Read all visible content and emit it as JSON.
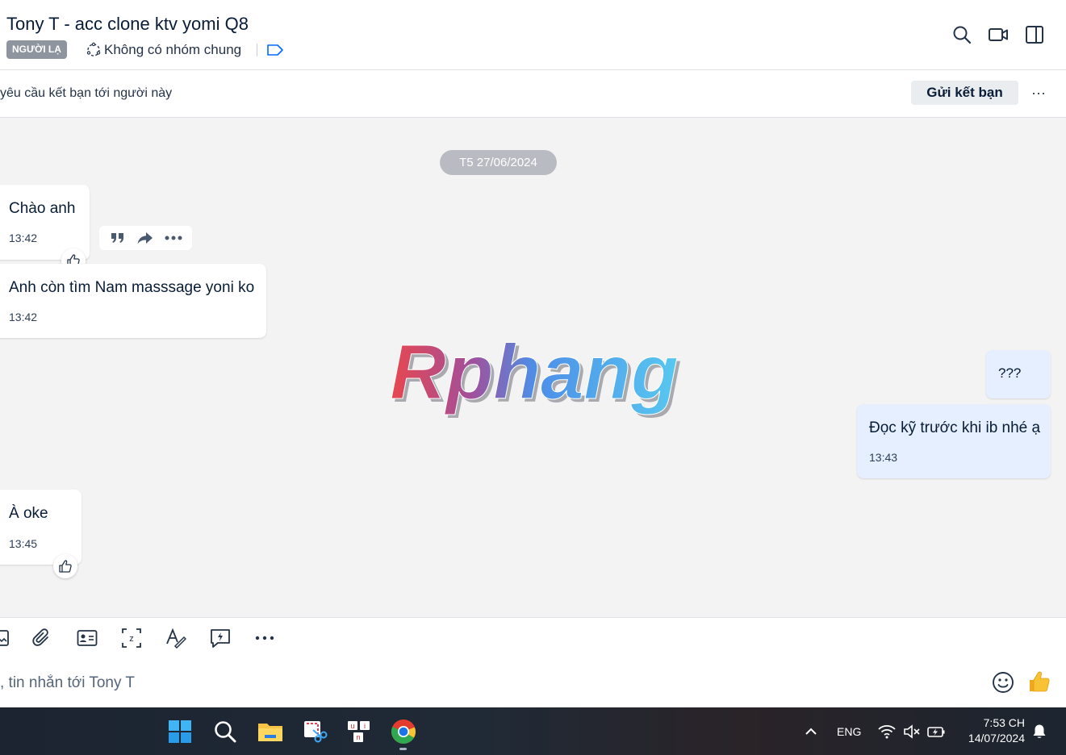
{
  "header": {
    "title": "Tony T - acc clone ktv yomi Q8",
    "badge": "NGƯỜI LẠ",
    "group_info": "Không có nhóm chung"
  },
  "friend_bar": {
    "text": "yêu cầu kết bạn tới người này",
    "button": "Gửi kết bạn",
    "more": "···"
  },
  "chat": {
    "date_separator": "T5 27/06/2024",
    "messages": [
      {
        "text": "Chào anh",
        "time": "13:42"
      },
      {
        "text": "Anh còn tìm Nam masssage yoni ko",
        "time": "13:42"
      },
      {
        "text": "???"
      },
      {
        "text": "Đọc kỹ trước khi ib nhé ạ",
        "time": "13:43"
      },
      {
        "text": "À oke",
        "time": "13:45"
      }
    ]
  },
  "watermark": "Rphang",
  "composer": {
    "placeholder": ", tin nhắn tới Tony T"
  },
  "taskbar": {
    "lang": "ENG",
    "time": "7:53 CH",
    "date": "14/07/2024"
  },
  "colors": {
    "accent": "#0068ff",
    "bubble_mine": "#e5efff",
    "chat_bg": "#f3f3f3"
  }
}
